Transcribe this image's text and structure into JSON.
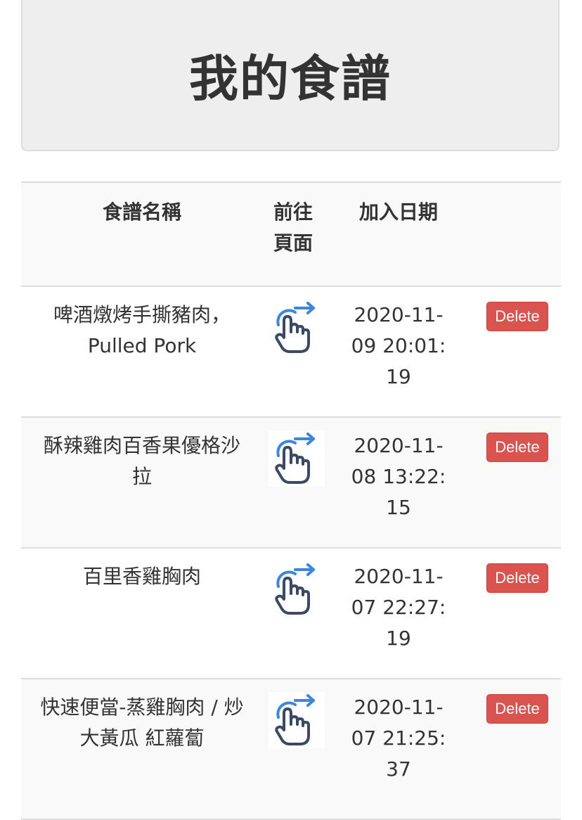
{
  "page": {
    "title": "我的食譜"
  },
  "table": {
    "headers": {
      "name": "食譜名稱",
      "link": "前往頁面",
      "date": "加入日期"
    },
    "rows": [
      {
        "name": "啤酒燉烤手撕豬肉，Pulled Pork",
        "link_icon": "tap-hand-arrow-icon",
        "date": "2020-11-09 20:01:19",
        "delete_label": "Delete"
      },
      {
        "name": "酥辣雞肉百香果優格沙拉",
        "link_icon": "tap-hand-arrow-icon",
        "date": "2020-11-08 13:22:15",
        "delete_label": "Delete"
      },
      {
        "name": "百里香雞胸肉",
        "link_icon": "tap-hand-arrow-icon",
        "date": "2020-11-07 22:27:19",
        "delete_label": "Delete"
      },
      {
        "name": "快速便當-蒸雞胸肉 / 炒大黃瓜 紅蘿蔔",
        "link_icon": "tap-hand-arrow-icon",
        "date": "2020-11-07 21:25:37",
        "delete_label": "Delete"
      }
    ]
  },
  "colors": {
    "delete_button": "#d9534f",
    "icon_arrow": "#3b86e0",
    "icon_hand": "#3a4a66",
    "header_background": "#eeeeee",
    "stripe": "#f9f9f9"
  }
}
